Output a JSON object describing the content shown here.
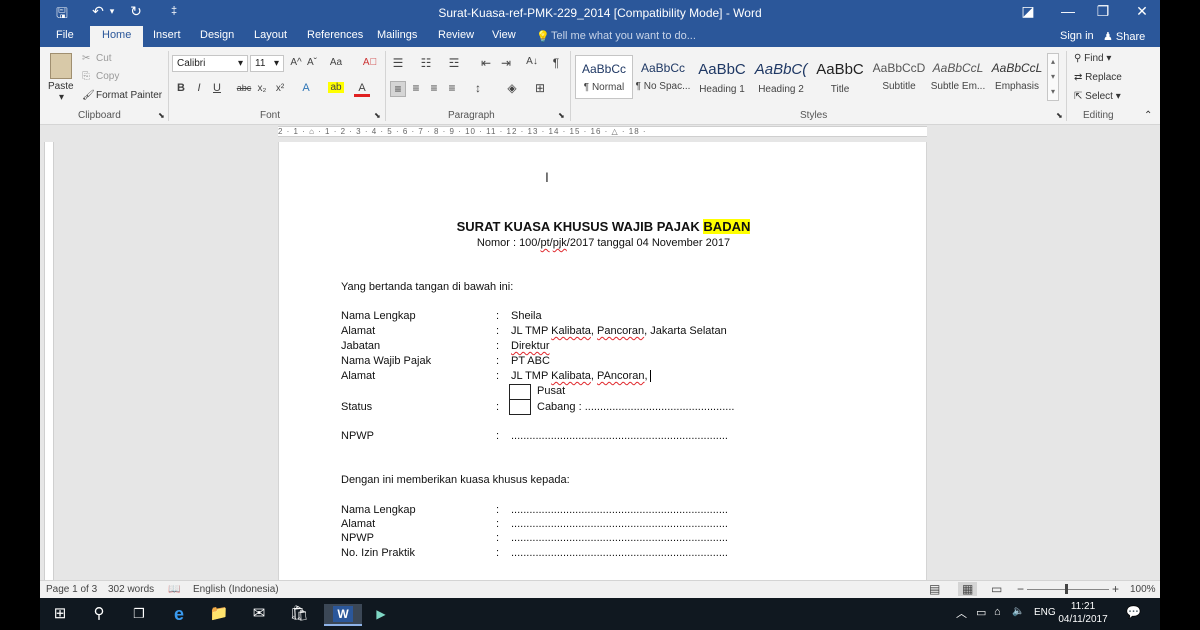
{
  "window": {
    "title": "Surat-Kuasa-ref-PMK-229_2014 [Compatibility Mode] - Word",
    "quick_access": {
      "save": "🖫",
      "undo": "↶",
      "undo_dd": "▾",
      "redo": "↻",
      "customize": "‡"
    },
    "controls": {
      "ribbon_display": "◪",
      "minimize": "—",
      "restore": "❐",
      "close": "✕"
    }
  },
  "tabs": [
    "File",
    "Home",
    "Insert",
    "Design",
    "Layout",
    "References",
    "Mailings",
    "Review",
    "View"
  ],
  "active_tab": "Home",
  "tell_me": "Tell me what you want to do...",
  "tell_me_icon": "💡",
  "sign_in": "Sign in",
  "share": "Share",
  "ribbon": {
    "clipboard": {
      "label": "Clipboard",
      "paste": "Paste",
      "cut": "Cut",
      "copy": "Copy",
      "format_painter": "Format Painter"
    },
    "font": {
      "label": "Font",
      "font_name": "Calibri",
      "font_size": "11",
      "grow": "A^",
      "shrink": "Aˇ",
      "case": "Aa",
      "clear": "A⃠",
      "bold": "B",
      "italic": "I",
      "underline": "U",
      "strike": "abc",
      "subscript": "x₂",
      "superscript": "x²",
      "effects": "A",
      "highlight": "ab",
      "font_color": "A"
    },
    "paragraph": {
      "label": "Paragraph",
      "bullets": "☰",
      "numbering": "☷",
      "multilevel": "☲",
      "decrease_indent": "⇤",
      "increase_indent": "⇥",
      "sort": "A↓",
      "pilcrow": "¶",
      "align_left": "≡",
      "center": "≡",
      "align_right": "≡",
      "justify": "≡",
      "line_spacing": "↕",
      "shading": "◈",
      "borders": "⊞"
    },
    "styles": {
      "label": "Styles",
      "items": [
        {
          "sample": "AaBbCc",
          "name": "¶ Normal"
        },
        {
          "sample": "AaBbCc",
          "name": "¶ No Spac..."
        },
        {
          "sample": "AaBbC",
          "name": "Heading 1"
        },
        {
          "sample": "AaBbC(",
          "name": "Heading 2"
        },
        {
          "sample": "AaBbC",
          "name": "Title"
        },
        {
          "sample": "AaBbCcD",
          "name": "Subtitle"
        },
        {
          "sample": "AaBbCcL",
          "name": "Subtle Em..."
        },
        {
          "sample": "AaBbCcL",
          "name": "Emphasis"
        }
      ]
    },
    "editing": {
      "label": "Editing",
      "find": "Find",
      "replace": "Replace",
      "select": "Select"
    }
  },
  "ruler": {
    "marks": "2 · 1 · ⌂ · 1 · 2 · 3 · 4 · 5 · 6 · 7 · 8 · 9 · 10 · 11 · 12 · 13 · 14 · 15 · 16 · △ · 18 ·"
  },
  "document": {
    "title_prefix": "SURAT KUASA KHUSUS WAJIB PAJAK",
    "title_highlight": "BADAN",
    "nomor": {
      "pre": "Nomor : 100/",
      "pt": "pt",
      "mid": "/",
      "pjk": "pjk",
      "post": "/2017 tanggal 04 November 2017"
    },
    "intro": "Yang bertanda tangan di bawah ini:",
    "colon": ":",
    "principal": {
      "nama_label": "Nama Lengkap",
      "nama_value": "Sheila",
      "alamat_label": "Alamat",
      "alamat_value": {
        "a": "JL TMP ",
        "kalibata": "Kalibata",
        "b": ", ",
        "pancoran": "Pancoran",
        "c": ", Jakarta Selatan"
      },
      "jabatan_label": "Jabatan",
      "jabatan_value": "Direktur",
      "wp_label": "Nama Wajib Pajak",
      "wp_value": "PT ABC",
      "alamat2_label": "Alamat",
      "alamat2_value": {
        "a": "JL TMP ",
        "kalibata": "Kalibata",
        "b": ", ",
        "pancoran": "PAncoran",
        "c": ","
      },
      "pusat": "Pusat",
      "status_label": "Status",
      "cabang": "Cabang : .................................................",
      "npwp_label": "NPWP",
      "npwp_value": "......................................................................."
    },
    "kuasa_intro": "Dengan ini memberikan kuasa khusus kepada:",
    "attorney": {
      "nama_label": "Nama Lengkap",
      "alamat_label": "Alamat",
      "npwp_label": "NPWP",
      "izin_label": "No. Izin Praktik",
      "dots": "......................................................................."
    }
  },
  "status_bar": {
    "page": "Page 1 of 3",
    "words": "302 words",
    "proofing_icon": "📖",
    "language": "English (Indonesia)",
    "read_mode": "▤",
    "print_layout": "▦",
    "web_layout": "▭",
    "zoom_out": "−",
    "zoom_in": "+",
    "zoom": "100%",
    "zoom_level_percent": 100
  },
  "taskbar": {
    "start": "⊞",
    "search": "⚲",
    "task_view": "❐",
    "edge": "e",
    "explorer": "📁",
    "mail": "✉",
    "store": "🛍",
    "word": "W",
    "app": "▶",
    "tray_up": "︿",
    "battery": "▭",
    "network": "⌂",
    "volume": "🔈",
    "lang": "ENG",
    "time": "11:21",
    "date": "04/11/2017",
    "notifications": "💬"
  }
}
